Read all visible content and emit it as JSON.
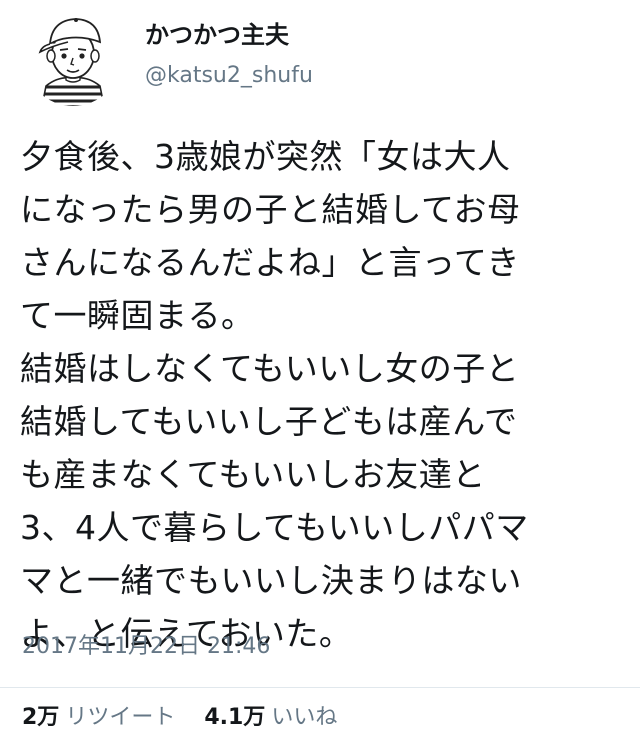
{
  "author": {
    "display_name": "かつかつ主夫",
    "handle": "@katsu2_shufu",
    "avatar_icon": "cartoon-man-avatar-icon"
  },
  "tweet": {
    "lines": [
      "夕食後、3歳娘が突然「女は大人",
      "になったら男の子と結婚してお母",
      "さんになるんだよね」と言ってき",
      "て一瞬固まる。",
      "結婚はしなくてもいいし女の子と",
      "結婚してもいいし子どもは産んで",
      "も産まなくてもいいしお友達と",
      "3、4人で暮らしてもいいしパパマ",
      "マと一緒でもいいし決まりはない",
      "よ、と伝えておいた。"
    ],
    "timestamp": "2017年11月22日 21:46"
  },
  "stats": {
    "retweets": {
      "count": "2万",
      "label": "リツイート"
    },
    "likes": {
      "count": "4.1万",
      "label": "いいね"
    }
  },
  "colors": {
    "text": "#14171a",
    "secondary": "#657786",
    "divider": "#e1e8ed"
  }
}
